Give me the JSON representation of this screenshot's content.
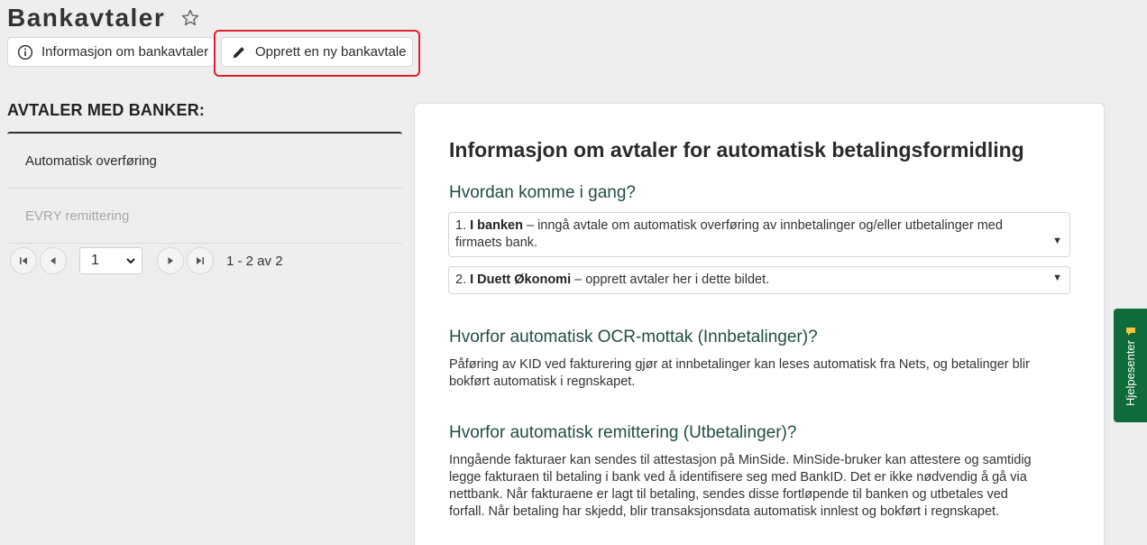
{
  "header": {
    "title": "Bankavtaler",
    "info_button": "Informasjon om bankavtaler",
    "create_button": "Opprett en ny bankavtale"
  },
  "sidebar": {
    "title": "AVTALER MED BANKER:",
    "items": [
      {
        "label": "Automatisk overføring",
        "state": "active"
      },
      {
        "label": "EVRY remittering",
        "state": "disabled"
      }
    ],
    "pager": {
      "page": "1",
      "count": "1 - 2 av 2"
    }
  },
  "panel": {
    "heading": "Informasjon om avtaler for automatisk betalingsformidling",
    "getting_started": {
      "title": "Hvordan komme i gang?",
      "steps": [
        {
          "num": "1.",
          "bold": "I banken",
          "text": " – inngå avtale om automatisk overføring av innbetalinger og/eller utbetalinger med firmaets bank."
        },
        {
          "num": "2.",
          "bold": "I Duett Økonomi",
          "text": " – opprett avtaler her i dette bildet."
        }
      ]
    },
    "ocr": {
      "title": "Hvorfor automatisk OCR-mottak (Innbetalinger)?",
      "text": "Påføring av KID ved fakturering gjør at innbetalinger kan leses automatisk fra Nets, og betalinger blir bokført automatisk i regnskapet."
    },
    "remittance": {
      "title": "Hvorfor automatisk remittering (Utbetalinger)?",
      "text": "Inngående fakturaer kan sendes til attestasjon på MinSide. MinSide-bruker kan attestere og samtidig legge fakturaen til betaling i bank ved å identifisere seg med BankID. Det er ikke nødvendig å gå via nettbank. Når fakturaene er lagt til betaling, sendes disse fortløpende til banken og utbetales ved forfall. Når betaling har skjedd, blir transaksjonsdata automatisk innlest og bokført i regnskapet."
    }
  },
  "help": {
    "label": "Hjelpesenter"
  },
  "colors": {
    "accent_green": "#0f6b3a",
    "highlight_red": "#e0202a",
    "heading_green": "#1f4e42"
  }
}
